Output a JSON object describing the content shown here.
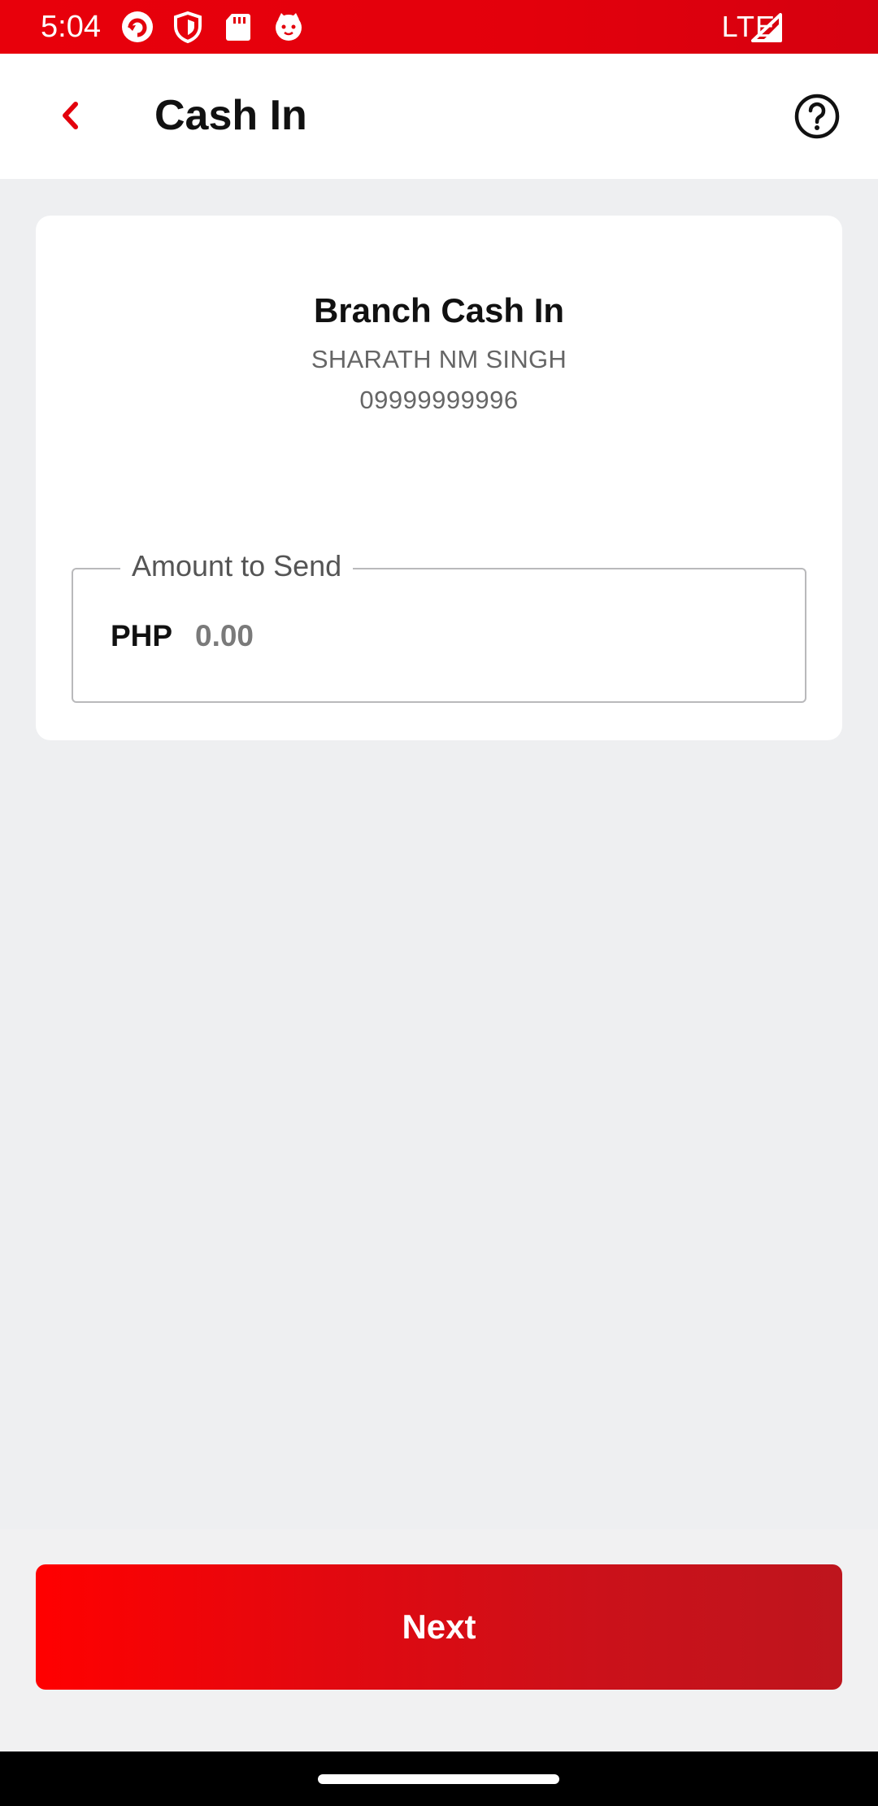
{
  "status_bar": {
    "time": "5:04",
    "network": "LTE",
    "icons": [
      "refresh-app-icon",
      "shield-icon",
      "sd-card-icon",
      "cat-face-icon",
      "signal-icon"
    ]
  },
  "header": {
    "title": "Cash In",
    "back_icon": "chevron-left-icon",
    "help_icon": "help-circle-icon"
  },
  "card": {
    "title": "Branch Cash In",
    "name": "SHARATH NM SINGH",
    "phone": "09999999996"
  },
  "amount": {
    "label": "Amount to Send",
    "currency": "PHP",
    "placeholder": "0.00",
    "value": ""
  },
  "actions": {
    "next_label": "Next"
  },
  "colors": {
    "brand_red": "#e3000c",
    "button_start": "#ff0000",
    "button_end": "#be151d",
    "background": "#eeeff1"
  }
}
